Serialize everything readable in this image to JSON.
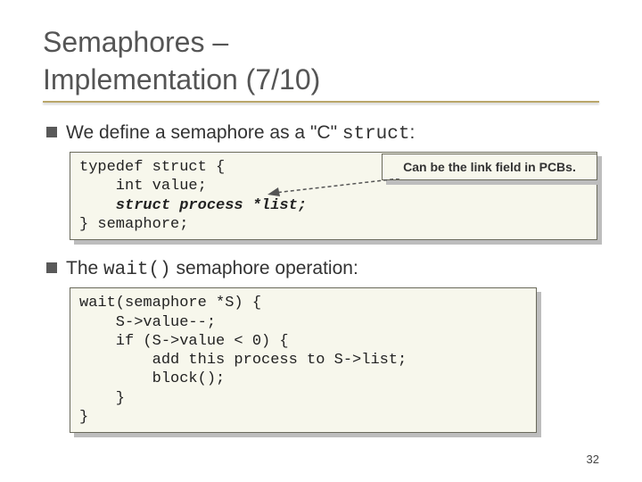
{
  "title_line1": "Semaphores –",
  "title_line2": "Implementation (7/10)",
  "bullet1_prefix": "We define a semaphore as a \"C\" ",
  "bullet1_code": "struct",
  "bullet1_suffix": ":",
  "code1_a": "typedef struct {",
  "code1_b": "    int value;",
  "code1_c": "    struct process *list;",
  "code1_d": "} semaphore;",
  "callout": "Can be the link field in PCBs.",
  "bullet2_prefix": "The ",
  "bullet2_code": "wait()",
  "bullet2_suffix": " semaphore operation:",
  "code2": "wait(semaphore *S) {\n    S->value--;\n    if (S->value < 0) {\n        add this process to S->list;\n        block();\n    }\n}",
  "pagenum": "32",
  "chart_data": null
}
